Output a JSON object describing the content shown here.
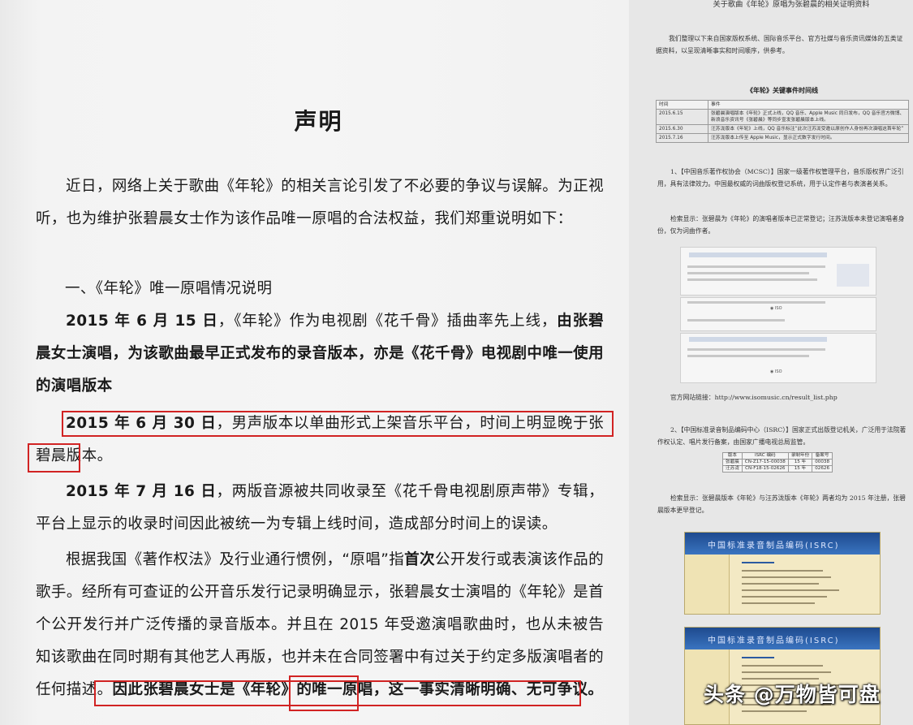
{
  "left_doc": {
    "title": "声明",
    "intro": "近日，网络上关于歌曲《年轮》的相关言论引发了不必要的争议与误解。为正视听，也为维护张碧晨女士作为该作品唯一原唱的合法权益，我们郑重说明如下：",
    "section1_heading": "一、《年轮》唯一原唱情况说明",
    "p1_bold_date": "2015 年 6 月 15 日",
    "p1_text": "，《年轮》作为电视剧《花千骨》插曲率先上线，",
    "p1_bold": "由张碧晨女士演唱，为该歌曲最早正式发布的录音版本，亦是《花千骨》电视剧中唯一使用的演唱版本",
    "p2_bold_date": "2015 年 6 月 30 日",
    "p2_text": "，男声版本以单曲形式上架音乐平台，时间上明显晚于张碧晨版本。",
    "p3_bold_date": "2015 年 7 月 16 日",
    "p3_text": "，两版音源被共同收录至《花千骨电视剧原声带》专辑，平台上显示的收录时间因此被统一为专辑上线时间，造成部分时间上的误读。",
    "p4_a": "根据我国《著作权法》及行业通行惯例，“原唱”指",
    "p4_bold": "首次",
    "p4_b": "公开发行或表演该作品的歌手。经所有可查证的公开音乐发行记录明确显示，张碧晨女士演唱的《年轮》是首个公开发行并广泛传播的录音版本。并且在 2015 年受邀演唱歌曲时，也从未被告知该歌曲在同时期有其他艺人再版，也并未在合同签署中有过关于约定多版演唱者的任何描述。",
    "p4_bold_end": "因此张碧晨女士是《年轮》的唯一原唱，这一事实清晰明确、无可争议。"
  },
  "right_doc": {
    "title": "关于歌曲《年轮》原唱为张碧晨的相关证明资料",
    "intro": "我们整理以下来自国家版权系统、国际音乐平台、官方社媒与音乐资讯媒体的五类证据资料，以呈现清晰事实和时间顺序，供参考。",
    "timeline_title": "《年轮》关键事件时间线",
    "timeline": {
      "headers": [
        "时间",
        "事件"
      ],
      "rows": [
        [
          "2015.6.15",
          "张碧晨演唱版本《年轮》正式上线，QQ 音乐、Apple Music 同日发布，QQ 音乐官方微博、新浪音乐资讯号《张碧晨》等同步宣发张碧晨版本上线。"
        ],
        [
          "2015.6.30",
          "汪苏泷版本《年轮》上线，QQ 音乐标注“此次汪苏泷受邀以原创作人身份再次演唱这首年轮”"
        ],
        [
          "2015.7.16",
          "汪苏泷版本上传至 Apple Music，显示正式数字发行时间。"
        ]
      ]
    },
    "mcsc_para": "1、【中国音乐著作权协会（MCSC）】国家一级著作权管理平台，音乐版权界广泛引用，具有法律效力。中国最权威的词曲版权登记系统，用于认定作者与表演者关系。",
    "mcsc_check": "检索显示：张碧晨为《年轮》的演唱者版本已正常登记；汪苏泷版本未登记演唱者身份，仅为词曲作者。",
    "official_link": "官方网站链接：http://www.isomusic.cn/result_list.php",
    "isrc_para": "2、【中国标准录音制品编码中心（ISRC）】国家正式出版登记机关，广泛用于法院著作权认定、唱片发行备案，由国家广播电视总局监管。",
    "isrc_table": {
      "headers": [
        "版本",
        "ISRC 编码",
        "录制年份",
        "备案号"
      ],
      "rows": [
        [
          "张碧晨",
          "CN-Z17-15-00038",
          "15 年",
          "00038"
        ],
        [
          "汪苏泷",
          "CN-F18-15-02626",
          "15 年",
          "02626"
        ]
      ]
    },
    "isrc_check": "检索显示：张碧晨版本《年轮》与汪苏泷版本《年轮》两者均为 2015 年注册，张碧晨版本更早登记。"
  },
  "watermark": "头条 @万物皆可盘",
  "colors": {
    "highlight_box": "#d12323",
    "page_bg": "#f5f5f5",
    "right_bg": "#e7e7e7"
  }
}
